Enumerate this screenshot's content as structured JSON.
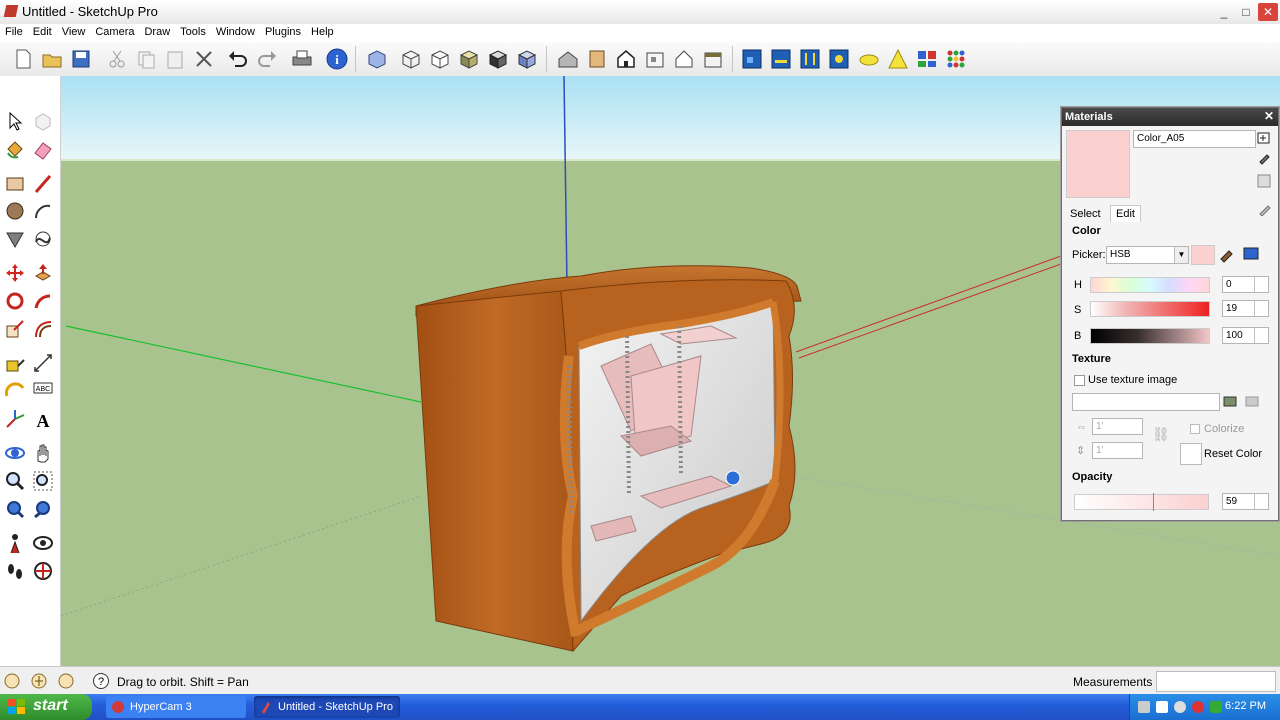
{
  "window": {
    "title": "Untitled - SketchUp Pro",
    "controls": {
      "minimize": "_",
      "maximize": "□",
      "close": "✕"
    }
  },
  "menu": [
    "File",
    "Edit",
    "View",
    "Camera",
    "Draw",
    "Tools",
    "Window",
    "Plugins",
    "Help"
  ],
  "toolbar_icons": [
    "new-icon",
    "open-icon",
    "save-icon",
    "cut-icon",
    "copy-icon",
    "paste-icon",
    "erase-icon",
    "undo-icon",
    "redo-icon",
    "print-icon",
    "model-info-icon",
    "xray-icon",
    "wireframe-icon",
    "hidden-line-icon",
    "shaded-icon",
    "shaded-textures-icon",
    "monochrome-icon",
    "iso-view-icon",
    "top-view-icon",
    "front-view-icon",
    "right-view-icon",
    "back-view-icon",
    "left-view-icon",
    "component-icon-1",
    "component-icon-2",
    "component-icon-3",
    "component-icon-4",
    "plugin-icon-1",
    "plugin-icon-2",
    "plugin-icon-3",
    "plugin-icon-4"
  ],
  "status": {
    "hint": "Drag to orbit.  Shift = Pan",
    "measurements_label": "Measurements"
  },
  "taskbar": {
    "start": "start",
    "tasks": [
      "HyperCam 3",
      "Untitled - SketchUp Pro"
    ],
    "clock": "6:22 PM"
  },
  "materials": {
    "title": "Materials",
    "close": "✕",
    "material_name": "Color_A05",
    "tabs": {
      "select": "Select",
      "edit": "Edit"
    },
    "color_heading": "Color",
    "picker_label": "Picker:",
    "picker_value": "HSB",
    "h_label": "H",
    "h_value": "0",
    "s_label": "S",
    "s_value": "19",
    "b_label": "B",
    "b_value": "100",
    "texture_heading": "Texture",
    "use_texture_label": "Use texture image",
    "width_placeholder": "1'",
    "height_placeholder": "1'",
    "colorize_label": "Colorize",
    "reset_color_label": "Reset Color",
    "opacity_heading": "Opacity",
    "opacity_value": "59",
    "swatch_color": "#fbd0d0"
  },
  "colors": {
    "sky": "#c9ecf6",
    "ground": "#a9c38f",
    "wood": "#b5631f",
    "accent_red": "#d21f1f"
  }
}
